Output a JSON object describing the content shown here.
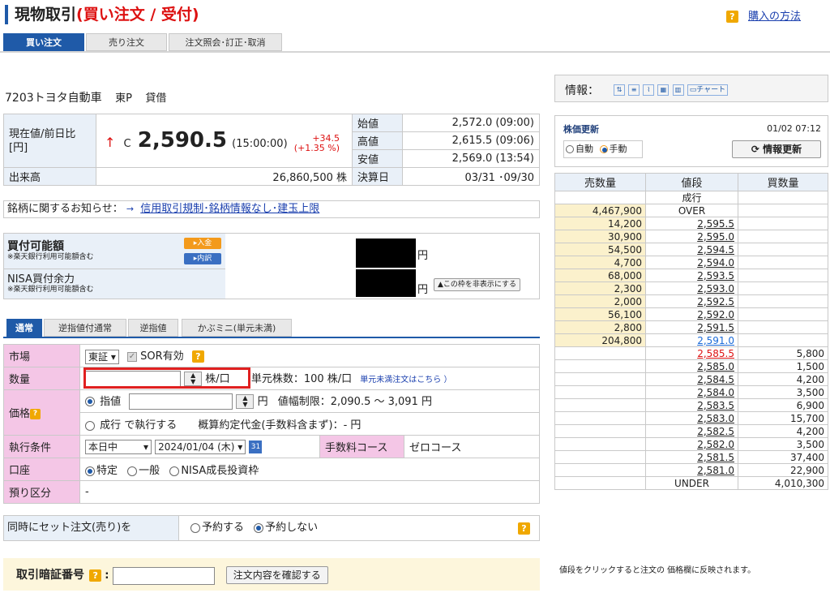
{
  "header": {
    "title_main": "現物取引",
    "title_sub": "(買い注文 / 受付)",
    "howto_icon": "?",
    "howto_label": "購入の方法"
  },
  "main_tabs": [
    {
      "label": "買い注文",
      "active": true
    },
    {
      "label": "売り注文",
      "active": false
    },
    {
      "label": "注文照会･訂正･取消",
      "active": false
    }
  ],
  "stock": {
    "code_name": "7203トヨタ自動車",
    "market": "東P",
    "margin": "貸借"
  },
  "price": {
    "label_current": "現在値/前日比[円]",
    "arrow": "↑",
    "flag": "C",
    "value": "2,590.5",
    "time": "(15:00:00)",
    "change": "+34.5",
    "change_pct": "(+1.35 %)",
    "open_label": "始値",
    "open_value": "2,572.0 (09:00)",
    "high_label": "高値",
    "high_value": "2,615.5 (09:06)",
    "low_label": "安値",
    "low_value": "2,569.0 (13:54)",
    "volume_label": "出来高",
    "volume_value": "26,860,500 株",
    "fiscal_label": "決算日",
    "fiscal_value": "03/31 ･09/30"
  },
  "notice": {
    "label": "銘柄に関するお知らせ：",
    "arrow": "→",
    "link": "信用取引規制･銘柄情報なし･建玉上限"
  },
  "funds": {
    "buy_label": "買付可能額",
    "buy_note": "※楽天銀行利用可能額含む",
    "deposit_btn": "▸入金",
    "detail_btn": "▸内訳",
    "yen": "円",
    "nisa_label": "NISA買付余力",
    "nisa_note": "※楽天銀行利用可能額含む",
    "hide_btn": "▲この枠を非表示にする"
  },
  "order_tabs": [
    {
      "label": "通常",
      "active": true
    },
    {
      "label": "逆指値付通常",
      "active": false
    },
    {
      "label": "逆指値",
      "active": false
    },
    {
      "label": "かぶミニ(単元未満)",
      "active": false
    }
  ],
  "form": {
    "market_label": "市場",
    "market_value": "東証",
    "sor_label": "SOR有効",
    "qty_label": "数量",
    "qty_value": "",
    "qty_unit": "株/口",
    "unit_label": "単元株数：100 株/口",
    "odd_lot_link": "単元未満注文はこちら ）",
    "price_label": "価格",
    "limit_label": "指値",
    "price_value": "",
    "yen": "円",
    "range_label": "値幅制限：2,090.5 ～ 3,091 円",
    "market_order_label": "成行 で執行する",
    "estimate_label": "概算約定代金(手数料含まず)：- 円",
    "exec_label": "執行条件",
    "exec_value": "本日中",
    "date_value": "2024/01/04 (木)",
    "calendar_icon": "31",
    "fee_label": "手数料コース",
    "fee_value": "ゼロコース",
    "account_label": "口座",
    "account_options": [
      "特定",
      "一般",
      "NISA成長投資枠"
    ],
    "deposit_label": "預り区分",
    "deposit_value": "-"
  },
  "set_order": {
    "label": "同時にセット注文(売り)を",
    "opt_reserve": "予約する",
    "opt_no": "予約しない"
  },
  "pin": {
    "label": "取引暗証番号",
    "colon": ":",
    "confirm_btn": "注文内容を確認する"
  },
  "info_toolbar": {
    "label": "情報：",
    "chart_label": "チャート"
  },
  "refresh": {
    "title": "株価更新",
    "timestamp": "01/02 07:12",
    "auto": "自動",
    "manual": "手動",
    "button": "情報更新"
  },
  "board": {
    "headers": [
      "売数量",
      "値段",
      "買数量"
    ],
    "rows": [
      {
        "sell": "",
        "price": "成行",
        "buy": "",
        "kind": "label"
      },
      {
        "sell": "4,467,900",
        "price": "OVER",
        "buy": "",
        "kind": "label"
      },
      {
        "sell": "14,200",
        "price": "2,595.5",
        "buy": "",
        "kind": "link"
      },
      {
        "sell": "30,900",
        "price": "2,595.0",
        "buy": "",
        "kind": "link"
      },
      {
        "sell": "54,500",
        "price": "2,594.5",
        "buy": "",
        "kind": "link"
      },
      {
        "sell": "4,700",
        "price": "2,594.0",
        "buy": "",
        "kind": "link"
      },
      {
        "sell": "68,000",
        "price": "2,593.5",
        "buy": "",
        "kind": "link"
      },
      {
        "sell": "2,300",
        "price": "2,593.0",
        "buy": "",
        "kind": "link"
      },
      {
        "sell": "2,000",
        "price": "2,592.5",
        "buy": "",
        "kind": "link"
      },
      {
        "sell": "56,100",
        "price": "2,592.0",
        "buy": "",
        "kind": "link"
      },
      {
        "sell": "2,800",
        "price": "2,591.5",
        "buy": "",
        "kind": "link"
      },
      {
        "sell": "204,800",
        "price": "2,591.0",
        "buy": "",
        "kind": "blue"
      },
      {
        "sell": "",
        "price": "2,585.5",
        "buy": "5,800",
        "kind": "red"
      },
      {
        "sell": "",
        "price": "2,585.0",
        "buy": "1,500",
        "kind": "link"
      },
      {
        "sell": "",
        "price": "2,584.5",
        "buy": "4,200",
        "kind": "link"
      },
      {
        "sell": "",
        "price": "2,584.0",
        "buy": "3,500",
        "kind": "link"
      },
      {
        "sell": "",
        "price": "2,583.5",
        "buy": "6,900",
        "kind": "link"
      },
      {
        "sell": "",
        "price": "2,583.0",
        "buy": "15,700",
        "kind": "link"
      },
      {
        "sell": "",
        "price": "2,582.5",
        "buy": "4,200",
        "kind": "link"
      },
      {
        "sell": "",
        "price": "2,582.0",
        "buy": "3,500",
        "kind": "link"
      },
      {
        "sell": "",
        "price": "2,581.5",
        "buy": "37,400",
        "kind": "link"
      },
      {
        "sell": "",
        "price": "2,581.0",
        "buy": "22,900",
        "kind": "link"
      },
      {
        "sell": "",
        "price": "UNDER",
        "buy": "4,010,300",
        "kind": "label"
      }
    ],
    "footnote": "値段をクリックすると注文の 価格欄に反映されます。"
  }
}
